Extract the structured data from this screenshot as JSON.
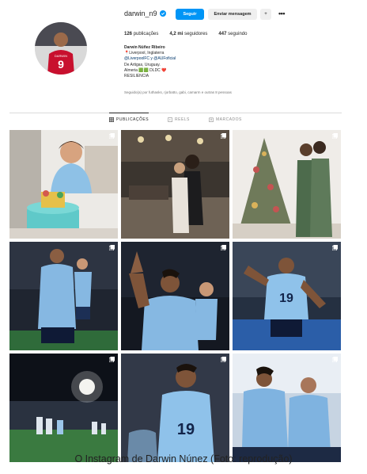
{
  "profile": {
    "username": "darwin_n9",
    "follow_label": "Seguir",
    "message_label": "Enviar mensagem",
    "add_user_glyph": "+",
    "more_glyph": "•••",
    "stats": {
      "posts": "126",
      "posts_label": "publicações",
      "followers": "4,2 mi",
      "followers_label": "seguidores",
      "following": "447",
      "following_label": "seguindo"
    },
    "bio": {
      "name": "Darwin Núñez Ribeiro",
      "line1": "📍Liverpool, Inglaterra",
      "line2": "@LiverpoolFC y @AUFoficial",
      "line3": "De Artigas, Uruguay.",
      "line4": "Almeria 🟩🟩 DLDC ❤️",
      "line5": "RESILIENCIA",
      "followed_by": "Seguido(a) por futhasks, rjorbatto, gabi, camarm e outras 8 pessoas"
    }
  },
  "tabs": [
    {
      "label": "PUBLICAÇÕES",
      "icon": "grid-icon",
      "active": true
    },
    {
      "label": "REELS",
      "icon": "reels-icon",
      "active": false
    },
    {
      "label": "MARCADOS",
      "icon": "tagged-icon",
      "active": false
    }
  ],
  "posts": [
    {
      "subject": "child-with-birthday-cake",
      "badge": "multi-photo-icon"
    },
    {
      "subject": "couple-in-decorated-dining-room",
      "badge": "multi-photo-icon"
    },
    {
      "subject": "couple-by-christmas-tree",
      "badge": "multi-photo-icon"
    },
    {
      "subject": "player-holding-child-stadium",
      "badge": "multi-photo-icon"
    },
    {
      "subject": "player-waving-with-child",
      "badge": "multi-photo-icon"
    },
    {
      "subject": "player-celebrating-number-19",
      "badge": "multi-photo-icon"
    },
    {
      "subject": "team-on-pitch-night",
      "badge": "multi-photo-icon"
    },
    {
      "subject": "player-19-closeup",
      "badge": "multi-photo-icon"
    },
    {
      "subject": "two-players-on-bench",
      "badge": "multi-photo-icon"
    }
  ],
  "caption": "O Instagram de Darwin Núnez (Foto: reprodução)",
  "colors": {
    "follow_button": "#0095f6",
    "uruguay_sky_blue": "#7fb3e0",
    "liverpool_red": "#c8102e"
  }
}
